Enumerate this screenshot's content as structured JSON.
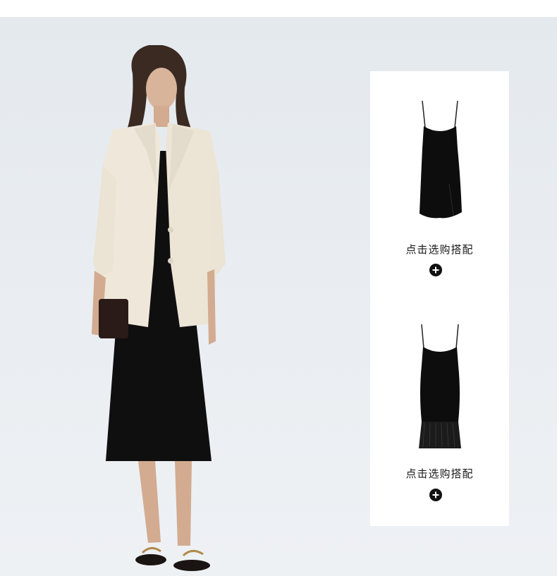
{
  "hero": {
    "image_description": "model-wearing-cream-blazer-over-black-slip-dress"
  },
  "products": [
    {
      "label": "点击选购搭配",
      "icon": "plus-icon",
      "image": "black-slip-dress-icon"
    },
    {
      "label": "点击选购搭配",
      "icon": "plus-icon",
      "image": "black-pleated-hem-slip-dress-icon"
    }
  ],
  "colors": {
    "background": "#e9edf1",
    "panel": "#ffffff",
    "button": "#111111"
  }
}
